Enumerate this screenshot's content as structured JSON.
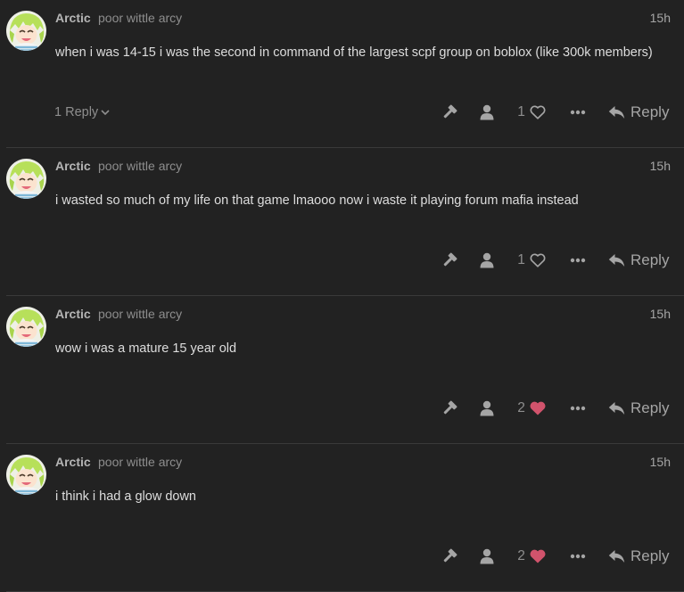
{
  "theme": {
    "background": "#222222",
    "text": "#dddddd",
    "muted": "#8e8e8e",
    "heart_liked": "#d1536c"
  },
  "posts": [
    {
      "username": "Arctic",
      "user_title": "poor wittle arcy",
      "time": "15h",
      "body": "when i was 14-15 i was the second in command of the largest scpf group on boblox (like 300k members)",
      "replies_label": "1 Reply",
      "likes": "1",
      "liked": false,
      "reply_label": "Reply",
      "icons": [
        "wrench-icon",
        "user-icon",
        "heart-outline-icon",
        "more-icon",
        "reply-icon"
      ]
    },
    {
      "username": "Arctic",
      "user_title": "poor wittle arcy",
      "time": "15h",
      "body": "i wasted so much of my life on that game lmaooo now i waste it playing forum mafia instead",
      "replies_label": "",
      "likes": "1",
      "liked": false,
      "reply_label": "Reply",
      "icons": [
        "wrench-icon",
        "user-icon",
        "heart-outline-icon",
        "more-icon",
        "reply-icon"
      ]
    },
    {
      "username": "Arctic",
      "user_title": "poor wittle arcy",
      "time": "15h",
      "body": "wow i was a mature 15 year old",
      "replies_label": "",
      "likes": "2",
      "liked": true,
      "reply_label": "Reply",
      "icons": [
        "wrench-icon",
        "user-icon",
        "heart-filled-icon",
        "more-icon",
        "reply-icon"
      ]
    },
    {
      "username": "Arctic",
      "user_title": "poor wittle arcy",
      "time": "15h",
      "body": "i think i had a glow down",
      "replies_label": "",
      "likes": "2",
      "liked": true,
      "reply_label": "Reply",
      "icons": [
        "wrench-icon",
        "user-icon",
        "heart-filled-icon",
        "more-icon",
        "reply-icon"
      ]
    }
  ]
}
